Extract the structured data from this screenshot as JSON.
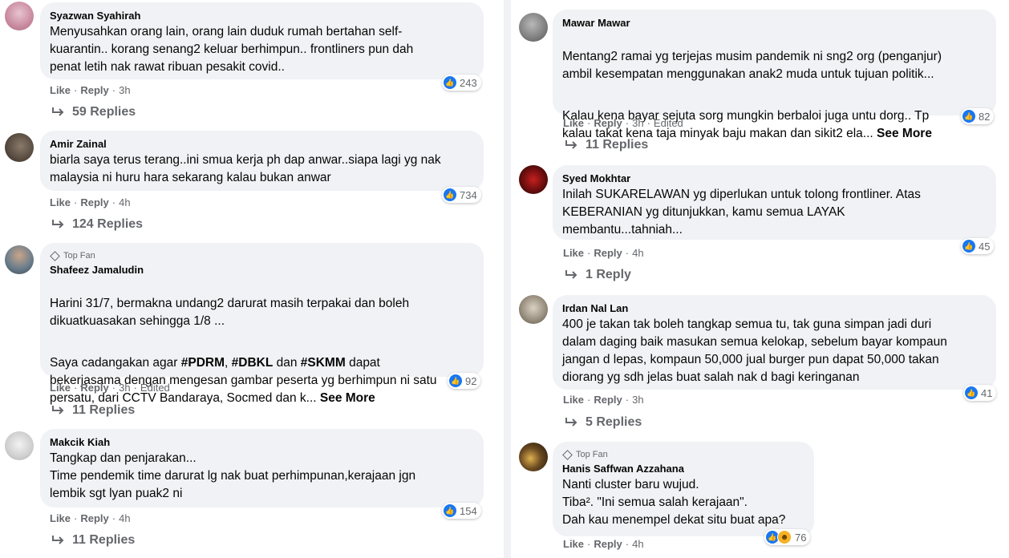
{
  "left_comments": [
    {
      "author": "Syazwan Syahirah",
      "badge": "",
      "paragraphs": [
        "Menyusahkan orang lain, orang lain duduk rumah bertahan self-\nkuarantin.. korang senang2 keluar berhimpun.. frontliners pun dah\npenat letih nak rawat ribuan pesakit covid.."
      ],
      "see_more": "",
      "like": "Like",
      "reply": "Reply",
      "time": "3h",
      "edited": "",
      "reaction_count": "243",
      "replies_label": "59 Replies",
      "avatar_color": "#d9a3b5"
    },
    {
      "author": "Amir Zainal",
      "badge": "",
      "paragraphs": [
        "biarla saya terus terang..ini smua kerja ph dap anwar..siapa lagi yg nak\nmalaysia ni huru hara sekarang kalau bukan anwar"
      ],
      "see_more": "",
      "like": "Like",
      "reply": "Reply",
      "time": "4h",
      "edited": "",
      "reaction_count": "734",
      "replies_label": "124 Replies",
      "avatar_color": "#6b5a4e"
    },
    {
      "author": "Shafeez Jamaludin",
      "badge": "Top Fan",
      "paragraphs": [
        "Harini 31/7, bermakna undang2 darurat masih terpakai dan boleh\ndikuatkuasakan sehingga 1/8 ..."
      ],
      "para2_pre": "Saya cadangakan agar ",
      "hashtags": [
        "#PDRM",
        "#DBKL",
        "#SKMM"
      ],
      "joiners": [
        ", ",
        " dan ",
        " dapat"
      ],
      "para2_post": "bekerjasama dengan mengesan gambar peserta yg berhimpun ni satu\npersatu, dari CCTV Bandaraya, Socmed dan k... ",
      "see_more": "See More",
      "like": "Like",
      "reply": "Reply",
      "time": "3h",
      "edited": "Edited",
      "reaction_count": "92",
      "replies_label": "11 Replies",
      "avatar_color": "#5c6f7d"
    },
    {
      "author": "Makcik Kiah",
      "badge": "",
      "paragraphs": [
        "Tangkap dan penjarakan...\nTime pendemik time darurat lg nak buat perhimpunan,kerajaan jgn\nlembik sgt lyan puak2 ni"
      ],
      "see_more": "",
      "like": "Like",
      "reply": "Reply",
      "time": "4h",
      "edited": "",
      "reaction_count": "154",
      "replies_label": "11 Replies",
      "avatar_color": "#d8d8d8"
    }
  ],
  "right_comments": [
    {
      "author": "Mawar Mawar",
      "badge": "",
      "paragraphs": [
        "Mentang2 ramai yg terjejas musim pandemik ni sng2 org (penganjur)\nambil kesempatan menggunakan anak2 muda untuk tujuan politik...",
        "Kalau kena bayar sejuta sorg mungkin berbaloi juga untu dorg.. Tp\nkalau takat kena taja minyak baju makan dan sikit2 ela... "
      ],
      "see_more": "See More",
      "like": "Like",
      "reply": "Reply",
      "time": "3h",
      "edited": "Edited",
      "reaction_count": "82",
      "replies_label": "11 Replies",
      "avatar_color": "#8a8a8a"
    },
    {
      "author": "Syed Mokhtar",
      "badge": "",
      "paragraphs": [
        "Inilah SUKARELAWAN yg diperlukan untuk tolong frontliner. Atas\nKEBERANIAN yg ditunjukkan, kamu semua LAYAK\nmembantu...tahniah..."
      ],
      "see_more": "",
      "like": "Like",
      "reply": "Reply",
      "time": "4h",
      "edited": "",
      "reaction_count": "45",
      "replies_label": "1 Reply",
      "avatar_color": "#7a1010"
    },
    {
      "author": "Irdan Nal Lan",
      "badge": "",
      "paragraphs": [
        "400 je takan tak boleh tangkap semua tu, tak guna simpan jadi duri\ndalam daging baik masukan semua kelokap, sebelum bayar kompaun\njangan d lepas, kompaun 50,000 jual burger pun dapat 50,000 takan\ndiorang yg sdh jelas buat salah nak d bagi keringanan"
      ],
      "see_more": "",
      "like": "Like",
      "reply": "Reply",
      "time": "3h",
      "edited": "",
      "reaction_count": "41",
      "replies_label": "5 Replies",
      "avatar_color": "#9a9080"
    },
    {
      "author": "Hanis Saffwan Azzahana",
      "badge": "Top Fan",
      "paragraphs": [
        "Nanti cluster baru wujud.\nTiba². \"Ini semua salah kerajaan\".\nDah kau menempel dekat situ buat apa?"
      ],
      "see_more": "",
      "like": "Like",
      "reply": "Reply",
      "time": "4h",
      "edited": "",
      "reaction_count": "76",
      "replies_label": "",
      "avatar_color": "#3b2a1a"
    }
  ],
  "colors": {
    "bubble": "#f0f2f5",
    "like_blue": "#1877f2",
    "meta_gray": "#65676b"
  }
}
